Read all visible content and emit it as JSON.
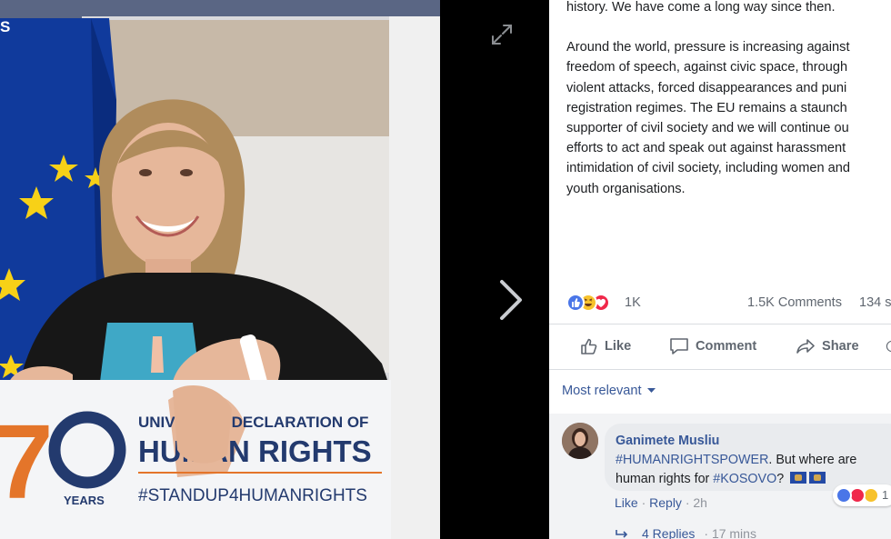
{
  "viewer": {
    "page_counter": "S",
    "banner": {
      "number": "70",
      "years": "YEARS",
      "title_top": "UNIVERSAL DECLARATION OF",
      "title_main": "HUMAN RIGHTS",
      "hashtag": "#STANDUP4HUMANRIGHTS"
    }
  },
  "post": {
    "paragraph1": [
      "history. We have come a long way since then."
    ],
    "paragraph2": [
      "Around the world, pressure is increasing against",
      "freedom of speech, against civic space, through",
      "violent attacks, forced disappearances and puni",
      "registration regimes. The EU remains a staunch",
      "supporter of civil society and we will continue ou",
      "efforts to act and speak out against harassment",
      "intimidation of civil society, including women and",
      "youth organisations."
    ]
  },
  "stats": {
    "reaction_count": "1K",
    "comments": "1.5K Comments",
    "shares": "134 s"
  },
  "actions": {
    "like": "Like",
    "comment": "Comment",
    "share": "Share"
  },
  "sort": {
    "label": "Most relevant"
  },
  "comment": {
    "author": "Ganimete Musliu",
    "hashtag1": "#HUMANRIGHTSPOWER",
    "text1": ". But where are",
    "text2": "human rights for ",
    "hashtag2": "#KOSOVO",
    "text3": "?",
    "like": "Like",
    "reply": "Reply",
    "time": "2h",
    "reactions_count": "1",
    "replies_label": "4 Replies",
    "replies_time": "17 mins"
  },
  "colors": {
    "link": "#385898",
    "muted": "#606770",
    "like_blue": "#4a76e8",
    "love_red": "#f0284a",
    "haha_yellow": "#f7c22c",
    "eu_blue": "#103a9c",
    "eu_star": "#f7d117",
    "banner_orange": "#e4752a",
    "banner_navy": "#233a6e"
  }
}
